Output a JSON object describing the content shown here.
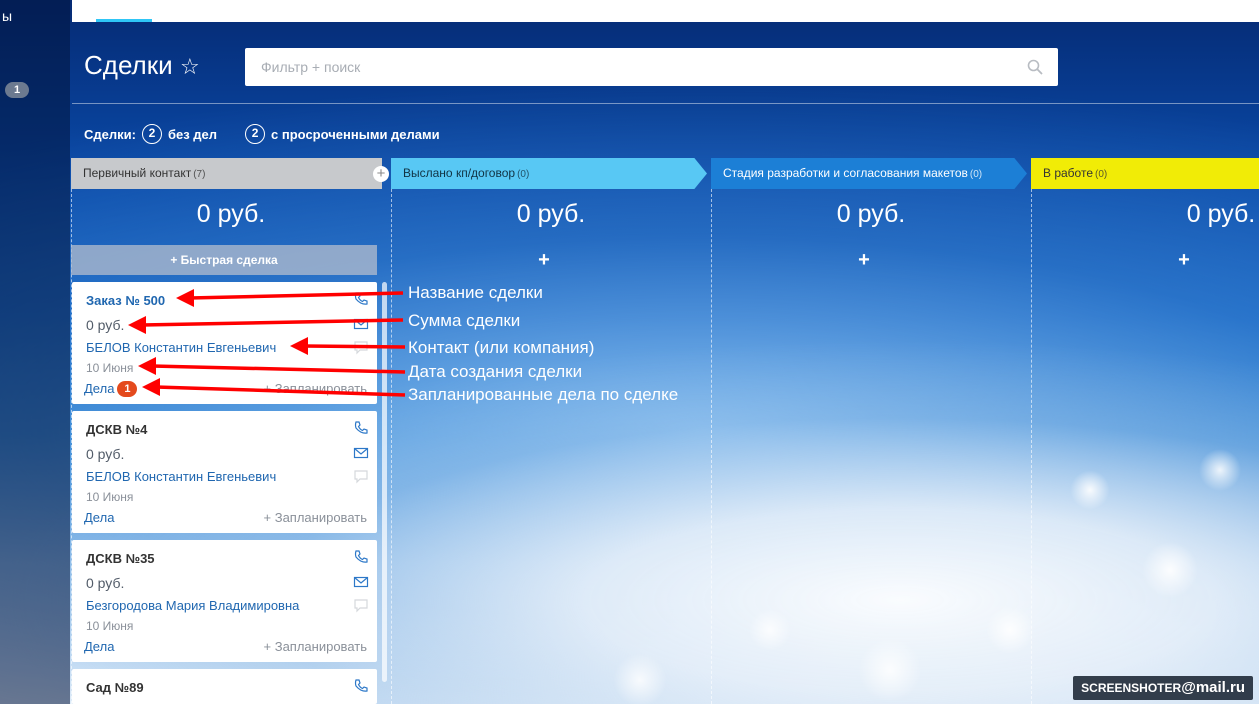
{
  "sidebar": {
    "partial_text": "ы",
    "badge": "1"
  },
  "header": {
    "title": "Сделки",
    "star": "☆"
  },
  "search": {
    "placeholder": "Фильтр + поиск"
  },
  "counters": {
    "label": "Сделки:",
    "no_deals_count": "2",
    "no_deals_label": "без дел",
    "overdue_count": "2",
    "overdue_label": "с просроченными делами"
  },
  "stages": [
    {
      "name": "Первичный контакт",
      "count": "(7)",
      "sum": "0 руб.",
      "color": "#c7c9cc"
    },
    {
      "name": "Выслано кп/договор",
      "count": "(0)",
      "sum": "0 руб.",
      "color": "#58c8f4"
    },
    {
      "name": "Стадия разработки и согласования макетов",
      "count": "(0)",
      "sum": "0 руб.",
      "color": "#1c7fd6"
    },
    {
      "name": "В работе",
      "count": "(0)",
      "sum": "0 руб.",
      "color": "#f1ec06"
    }
  ],
  "quick_deal": {
    "label": "+ Быстрая сделка",
    "plus": "+"
  },
  "cards": [
    {
      "title": "Заказ № 500",
      "sum": "0 руб.",
      "contact": "БЕЛОВ Константин Евгеньевич",
      "date": "10 Июня",
      "deals": "Дела",
      "badge": "1",
      "plan": "+ Запланировать"
    },
    {
      "title": "ДСКВ №4",
      "sum": "0 руб.",
      "contact": "БЕЛОВ Константин Евгеньевич",
      "date": "10 Июня",
      "deals": "Дела",
      "plan": "+ Запланировать"
    },
    {
      "title": "ДСКВ №35",
      "sum": "0 руб.",
      "contact": "Безгородова Мария Владимировна",
      "date": "10 Июня",
      "deals": "Дела",
      "plan": "+ Запланировать"
    },
    {
      "title": "Сад №89"
    }
  ],
  "annotations": [
    "Название сделки",
    "Сумма сделки",
    "Контакт (или компания)",
    "Дата создания сделки",
    "Запланированные дела по сделке"
  ],
  "watermark": {
    "text": "SCREENSHOTER",
    "domain": "@mail.ru"
  },
  "colors": {
    "accent": "#2fc6f6",
    "link": "#2067b0",
    "badge": "#e44a1d",
    "arrow": "#ff0000"
  }
}
